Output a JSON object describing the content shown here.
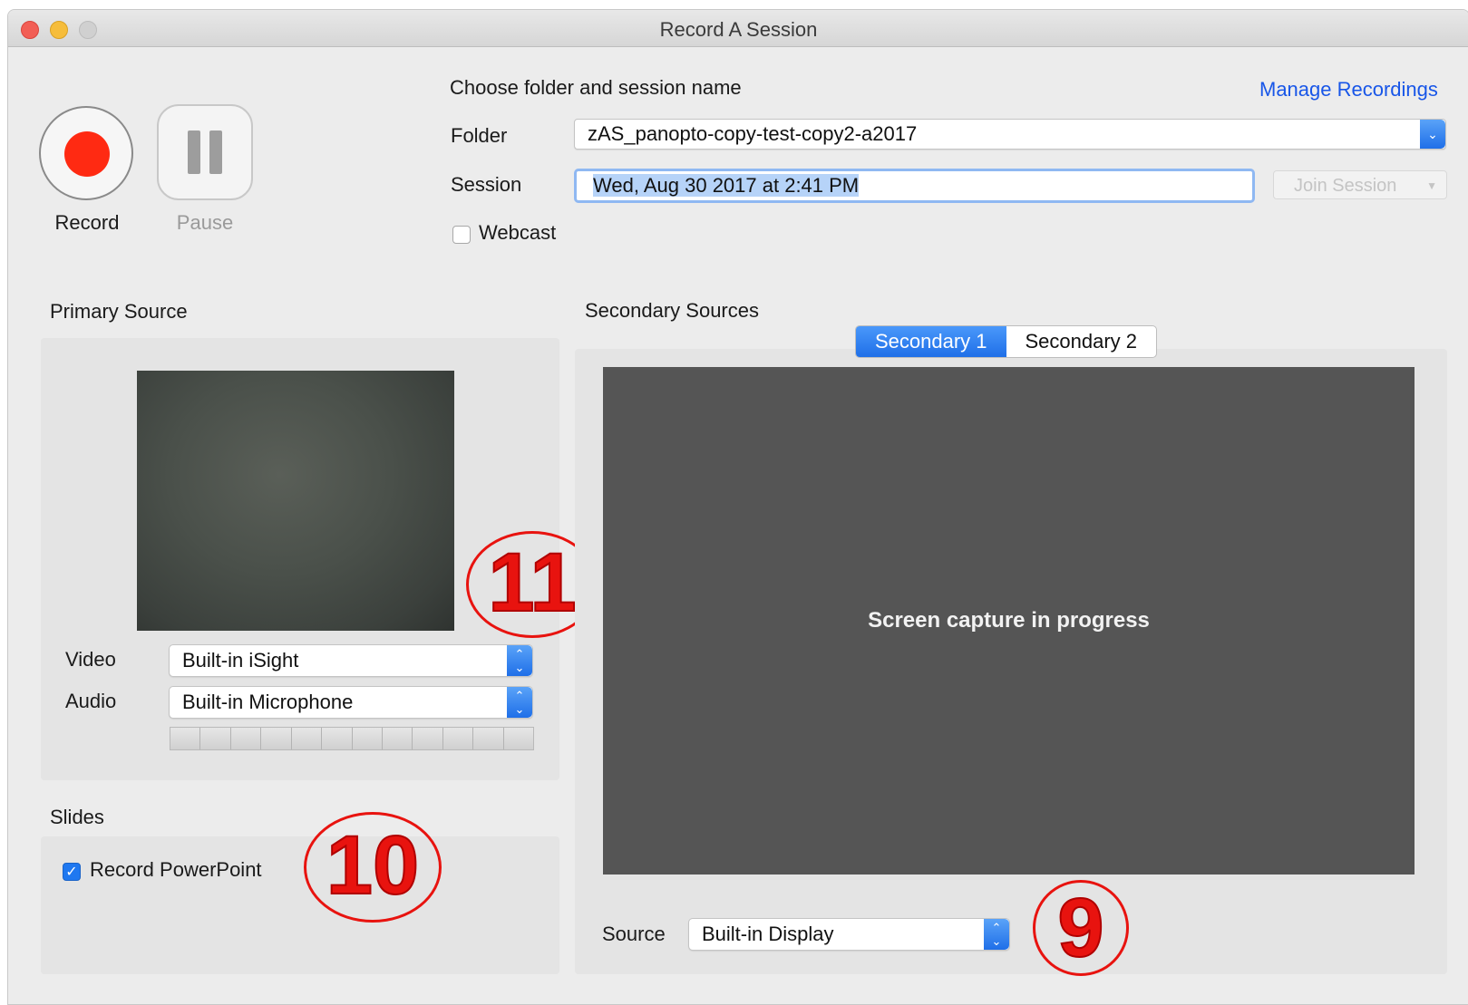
{
  "window": {
    "title": "Record A Session"
  },
  "controls": {
    "record_label": "Record",
    "pause_label": "Pause"
  },
  "session_setup": {
    "heading": "Choose folder and session name",
    "manage_link": "Manage Recordings",
    "folder_label": "Folder",
    "folder_value": "zAS_panopto-copy-test-copy2-a2017",
    "session_label": "Session",
    "session_value": "Wed, Aug 30 2017 at 2:41 PM",
    "join_session_label": "Join Session",
    "webcast_label": "Webcast",
    "webcast_checked": false
  },
  "primary": {
    "heading": "Primary Source",
    "video_label": "Video",
    "video_value": "Built-in iSight",
    "audio_label": "Audio",
    "audio_value": "Built-in Microphone"
  },
  "slides": {
    "heading": "Slides",
    "record_ppt_label": "Record PowerPoint",
    "record_ppt_checked": true
  },
  "secondary": {
    "heading": "Secondary Sources",
    "tabs": [
      {
        "label": "Secondary 1",
        "active": true
      },
      {
        "label": "Secondary 2",
        "active": false
      }
    ],
    "preview_message": "Screen capture in progress",
    "source_label": "Source",
    "source_value": "Built-in Display"
  },
  "annotations": [
    "11",
    "10",
    "9"
  ],
  "colors": {
    "accent": "#1f78f0",
    "record": "#ff2a12",
    "annotation": "#e8130f",
    "preview_bg": "#555555"
  }
}
